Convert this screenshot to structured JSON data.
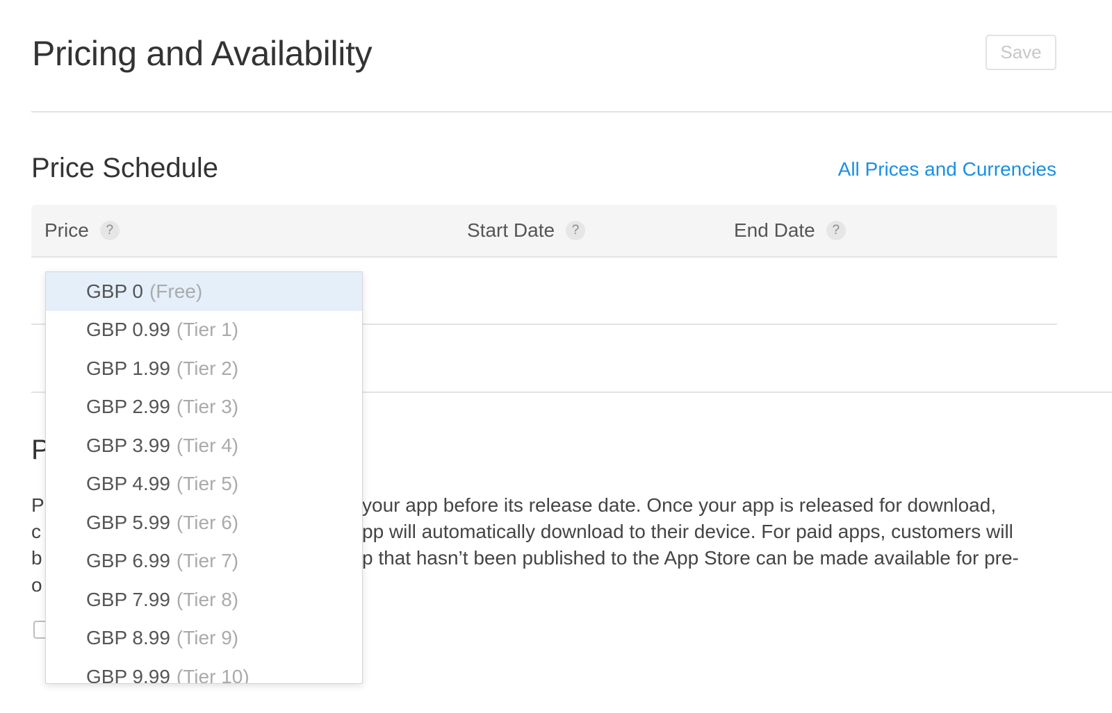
{
  "header": {
    "title": "Pricing and Availability",
    "save_label": "Save"
  },
  "price_schedule": {
    "title": "Price Schedule",
    "all_prices_link": "All Prices and Currencies",
    "columns": [
      {
        "label": "Price",
        "help": "?"
      },
      {
        "label": "Start Date",
        "help": "?"
      },
      {
        "label": "End Date",
        "help": "?"
      }
    ]
  },
  "preorder": {
    "title_fragment": "P",
    "description_lines": [
      {
        "left": "P",
        "right": "your app before its release date. Once your app is released for download,"
      },
      {
        "left": "c",
        "right": "pp will automatically download to their device. For paid apps, customers will"
      },
      {
        "left": "b",
        "right": "p that hasn’t been published to the App Store can be made available for pre-"
      },
      {
        "left": "o",
        "right": ""
      }
    ]
  },
  "price_dropdown": {
    "selected_index": 0,
    "options": [
      {
        "price": "GBP 0",
        "tier": "(Free)"
      },
      {
        "price": "GBP 0.99",
        "tier": "(Tier 1)"
      },
      {
        "price": "GBP 1.99",
        "tier": "(Tier 2)"
      },
      {
        "price": "GBP 2.99",
        "tier": "(Tier 3)"
      },
      {
        "price": "GBP 3.99",
        "tier": "(Tier 4)"
      },
      {
        "price": "GBP 4.99",
        "tier": "(Tier 5)"
      },
      {
        "price": "GBP 5.99",
        "tier": "(Tier 6)"
      },
      {
        "price": "GBP 6.99",
        "tier": "(Tier 7)"
      },
      {
        "price": "GBP 7.99",
        "tier": "(Tier 8)"
      },
      {
        "price": "GBP 8.99",
        "tier": "(Tier 9)"
      },
      {
        "price": "GBP 9.99",
        "tier": "(Tier 10)"
      }
    ]
  },
  "colors": {
    "link": "#1a8fe3",
    "selected_option_bg": "#e5effa",
    "header_bg": "#f5f5f5"
  }
}
